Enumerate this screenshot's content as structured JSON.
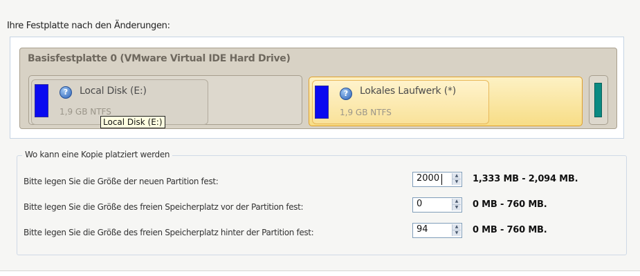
{
  "heading": "Ihre Festplatte nach den Änderungen:",
  "disk": {
    "title": "Basisfestplatte 0 (VMware Virtual IDE Hard Drive)",
    "partitions": [
      {
        "label": "Local Disk (E:)",
        "size": "1,9 GB NTFS",
        "bar_color": "#0a0af0",
        "icon": "help-icon"
      },
      {
        "label": "Lokales Laufwerk (*)",
        "size": "1,9 GB NTFS",
        "bar_color": "#0a0af0",
        "icon": "help-icon",
        "selected": true
      },
      {
        "bar_color": "#0a8a82"
      }
    ],
    "tooltip": "Local Disk (E:)"
  },
  "placement": {
    "title": "Wo kann eine Kopie platziert werden",
    "rows": [
      {
        "label": "Bitte legen Sie die Größe der neuen Partition fest:",
        "value": "2000",
        "range": "1,333 MB - 2,094 MB."
      },
      {
        "label": "Bitte legen Sie die Größe des freien Speicherplatz vor der Partition fest:",
        "value": "0",
        "range": "0 MB - 760 MB."
      },
      {
        "label": "Bitte legen Sie die Größe des freien Speicherplatz hinter der Partition fest:",
        "value": "94",
        "range": "0 MB - 760 MB."
      }
    ]
  },
  "icons": {
    "spin_up": "arrow-up-icon",
    "spin_down": "arrow-down-icon",
    "help": "help-icon"
  }
}
